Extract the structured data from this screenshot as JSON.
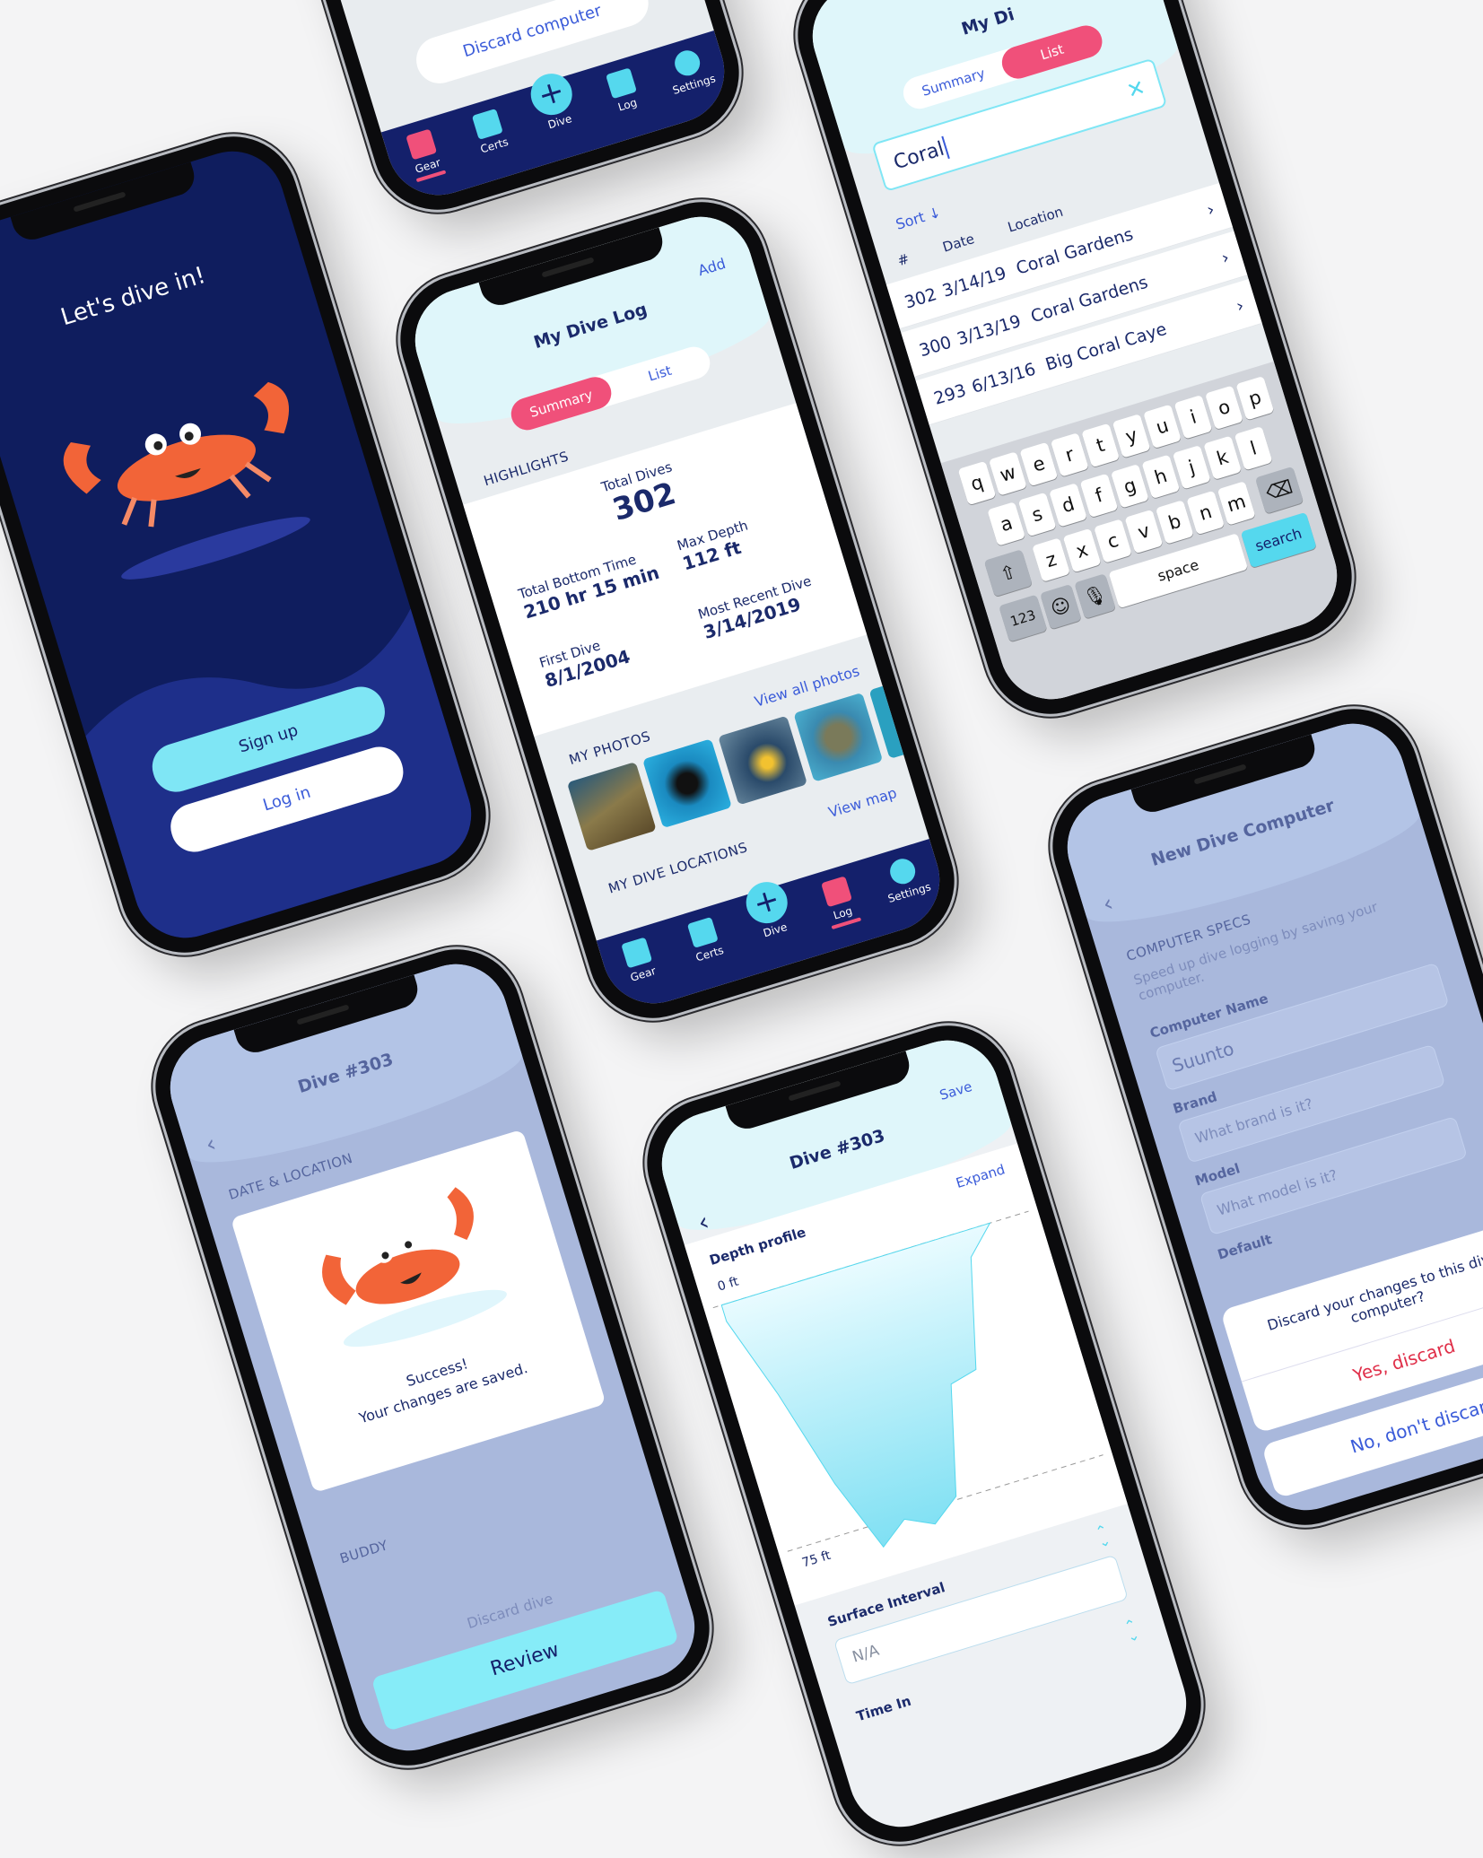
{
  "colors": {
    "navy": "#14206b",
    "pink": "#f0507a",
    "cyan": "#55d8ee",
    "link": "#3a5bd9",
    "crab": "#f26438"
  },
  "welcome": {
    "heading": "Let's dive in!",
    "sign_up": "Sign up",
    "log_in": "Log in"
  },
  "gear_screen": {
    "discard_button": "Discard computer"
  },
  "tabs": {
    "gear": "Gear",
    "certs": "Certs",
    "dive": "Dive",
    "log": "Log",
    "settings": "Settings"
  },
  "dive_log": {
    "title": "My Dive Log",
    "add": "Add",
    "segments": {
      "summary": "Summary",
      "list": "List"
    },
    "highlights_label": "HIGHLIGHTS",
    "stats": {
      "total_dives_label": "Total Dives",
      "total_dives": "302",
      "bottom_time_label": "Total Bottom Time",
      "bottom_time": "210 hr 15 min",
      "max_depth_label": "Max Depth",
      "max_depth": "112 ft",
      "first_dive_label": "First Dive",
      "first_dive": "8/1/2004",
      "recent_dive_label": "Most Recent Dive",
      "recent_dive": "3/14/2019"
    },
    "photos_label": "MY PHOTOS",
    "view_all_photos": "View all photos",
    "locations_label": "MY DIVE LOCATIONS",
    "view_map": "View map"
  },
  "search_list": {
    "title": "My Di",
    "search_value": "Coral",
    "sort": "Sort",
    "columns": {
      "num": "#",
      "date": "Date",
      "location": "Location"
    },
    "rows": [
      {
        "num": "302",
        "date": "3/14/19",
        "location": "Coral Gardens"
      },
      {
        "num": "300",
        "date": "3/13/19",
        "location": "Coral Gardens"
      },
      {
        "num": "293",
        "date": "6/13/16",
        "location": "Big Coral Caye"
      }
    ],
    "keyboard": {
      "row1": [
        "q",
        "w",
        "e",
        "r",
        "t",
        "y",
        "u",
        "i",
        "o",
        "p"
      ],
      "row2": [
        "a",
        "s",
        "d",
        "f",
        "g",
        "h",
        "j",
        "k",
        "l"
      ],
      "row3": [
        "z",
        "x",
        "c",
        "v",
        "b",
        "n",
        "m"
      ],
      "numbers": "123",
      "space": "space",
      "search": "search"
    }
  },
  "success_modal": {
    "bg_title": "Dive #303",
    "bg_section": "DATE & LOCATION",
    "bg_buddy": "BUDDY",
    "bg_discard": "Discard dive",
    "line1": "Success!",
    "line2": "Your changes are saved.",
    "review": "Review"
  },
  "dive_detail": {
    "title": "Dive #303",
    "save": "Save",
    "depth_profile": "Depth profile",
    "expand": "Expand",
    "top_label": "0 ft",
    "bottom_label": "75 ft",
    "depth_profile_ft": [
      5,
      30,
      60,
      82,
      76,
      80,
      74,
      42,
      40,
      8,
      0
    ],
    "surface_interval": "Surface Interval",
    "surface_interval_value": "N/A",
    "time_in": "Time In"
  },
  "new_computer": {
    "title": "New Dive Computer",
    "section": "COMPUTER SPECS",
    "description": "Speed up dive logging by saving your computer.",
    "name_label": "Computer Name",
    "name_value": "Suunto",
    "brand_label": "Brand",
    "brand_placeholder": "What brand is it?",
    "model_label": "Model",
    "model_placeholder": "What model is it?",
    "default_label": "Default",
    "sheet_message": "Discard your changes to this dive computer?",
    "yes": "Yes, discard",
    "no": "No, don't discard"
  }
}
